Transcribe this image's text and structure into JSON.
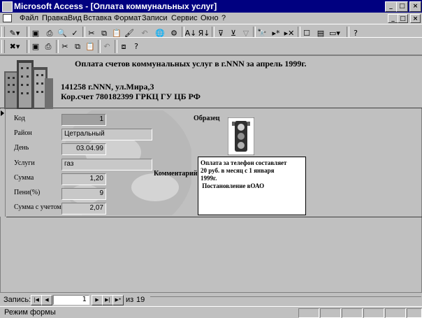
{
  "window": {
    "title": "Microsoft Access - [Оплата коммунальных услуг]"
  },
  "menu": [
    "Файл",
    "Правка",
    "Вид",
    "Вставка",
    "Формат",
    "Записи",
    "Сервис",
    "Окно",
    "?"
  ],
  "form": {
    "heading": "Оплата счетов коммунальных услуг в г.NNN за апрель 1999г.",
    "address": "141258 г.NNN, ул.Мира,3",
    "account": "Кор.счет 780182399 ГРКЦ ГУ ЦБ РФ",
    "labels": {
      "code": "Код",
      "district": "Район",
      "day": "День",
      "services": "Услуги",
      "sum": "Сумма",
      "penalty": "Пени(%)",
      "total": "Сумма с учетом",
      "sample": "Образец",
      "comment": "Комментарий"
    },
    "values": {
      "code": "1",
      "district": "Цетральный",
      "day": "03.04.99",
      "services": "газ",
      "sum": "1,20",
      "penalty": "9",
      "total": "2,07"
    },
    "comment_lines": [
      "Оплата за телефон составляет",
      "20 руб. в месяц с 1 января",
      "1999г.",
      " Постановление вОАО"
    ]
  },
  "navigation": {
    "label": "Запись:",
    "current": "1",
    "of_label": "из",
    "total": "19"
  },
  "status": {
    "text": "Режим формы"
  }
}
